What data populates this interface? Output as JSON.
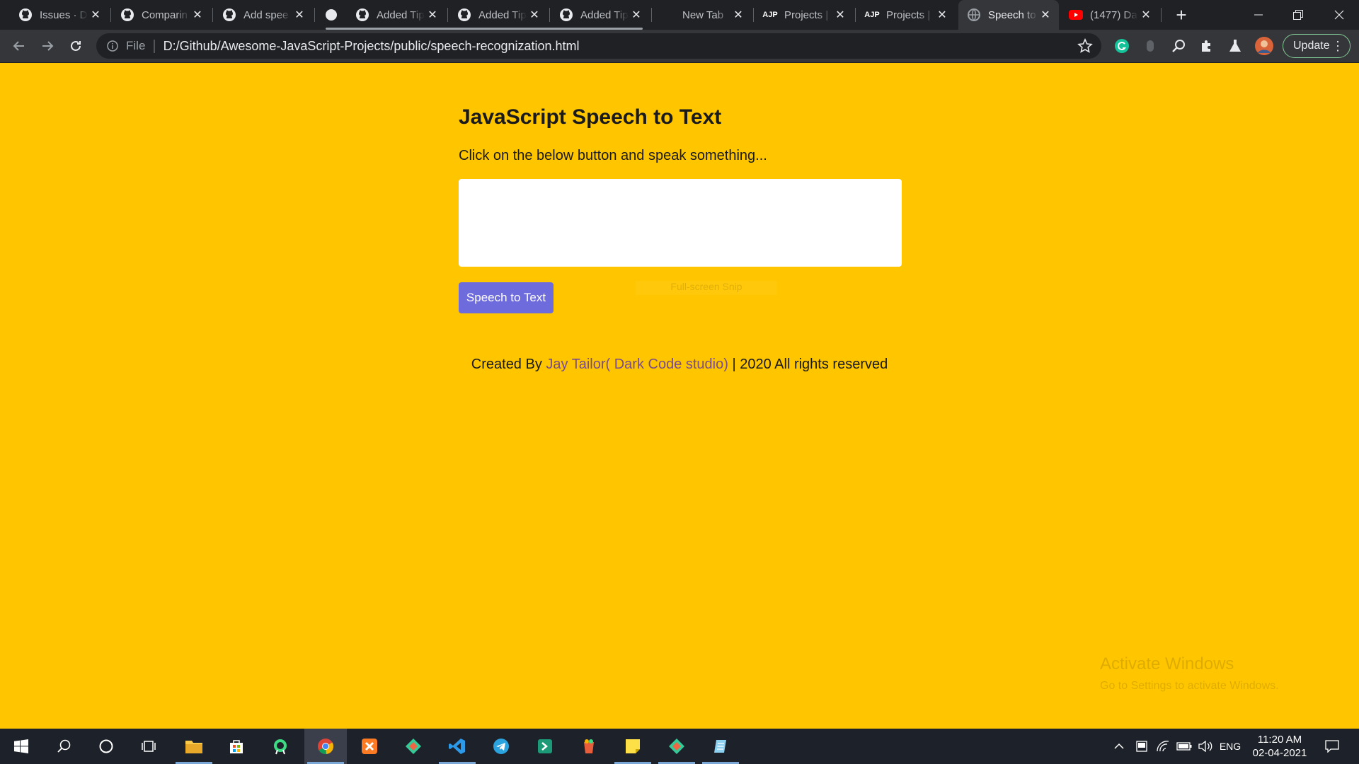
{
  "browser": {
    "tabs": [
      {
        "title": "Issues · D",
        "favicon": "github-icon"
      },
      {
        "title": "Comparin",
        "favicon": "github-icon"
      },
      {
        "title": "Add spee",
        "favicon": "github-icon"
      },
      {
        "title": "",
        "favicon": "circle-icon"
      },
      {
        "title": "Added Tip",
        "favicon": "github-icon"
      },
      {
        "title": "Added Tip",
        "favicon": "github-icon"
      },
      {
        "title": "Added Tip",
        "favicon": "github-icon"
      },
      {
        "title": "New Tab",
        "favicon": ""
      },
      {
        "title": "Projects |",
        "favicon": "ajp-icon"
      },
      {
        "title": "Projects |",
        "favicon": "ajp-icon"
      },
      {
        "title": "Speech to",
        "favicon": "globe-icon"
      },
      {
        "title": "(1477) Da",
        "favicon": "youtube-icon"
      }
    ],
    "omnibox": {
      "scheme": "File",
      "url": "D:/Github/Awesome-JavaScript-Projects/public/speech-recognization.html"
    },
    "update_label": "Update"
  },
  "page": {
    "title": "JavaScript Speech to Text",
    "instructions": "Click on the below button and speak something...",
    "result_text": "",
    "button_label": "Speech to Text",
    "snip_overlay": "Full-screen Snip",
    "footer": {
      "prefix": "Created By ",
      "author": "Jay Tailor( Dark Code studio)",
      "suffix": " | 2020 All rights reserved"
    }
  },
  "watermark": {
    "line1": "Activate Windows",
    "line2": "Go to Settings to activate Windows."
  },
  "taskbar": {
    "language": "ENG",
    "time": "11:20 AM",
    "date": "02-04-2021"
  },
  "colors": {
    "page_background": "#ffc600",
    "button": "#6e6bdc",
    "link": "#7a4c8a"
  }
}
